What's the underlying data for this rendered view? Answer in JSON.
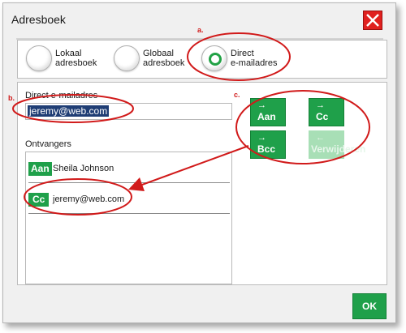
{
  "window": {
    "title": "Adresboek"
  },
  "source_options": [
    {
      "label_line1": "Lokaal",
      "label_line2": "adresboek",
      "selected": false
    },
    {
      "label_line1": "Globaal",
      "label_line2": "adresboek",
      "selected": false
    },
    {
      "label_line1": "Direct",
      "label_line2": "e-mailadres",
      "selected": true
    }
  ],
  "direct_email": {
    "label": "Direct e-mailadres",
    "value": "jeremy@web.com"
  },
  "recipients": {
    "label": "Ontvangers",
    "items": [
      {
        "type": "Aan",
        "address": "Sheila Johnson"
      },
      {
        "type": "Cc",
        "address": "jeremy@web.com"
      }
    ]
  },
  "actions": {
    "aan": {
      "label": "Aan",
      "arrow": "→"
    },
    "cc": {
      "label": "Cc",
      "arrow": "→"
    },
    "bcc": {
      "label": "Bcc",
      "arrow": "→"
    },
    "remove": {
      "label": "Verwijderen",
      "arrow": "←",
      "disabled": true
    }
  },
  "footer": {
    "ok_label": "OK"
  },
  "annotations": {
    "a": "a.",
    "b": "b.",
    "c": "c."
  },
  "colors": {
    "accent_green": "#1fa04a",
    "annotation_red": "#d11a1a",
    "close_red": "#e0201f"
  }
}
